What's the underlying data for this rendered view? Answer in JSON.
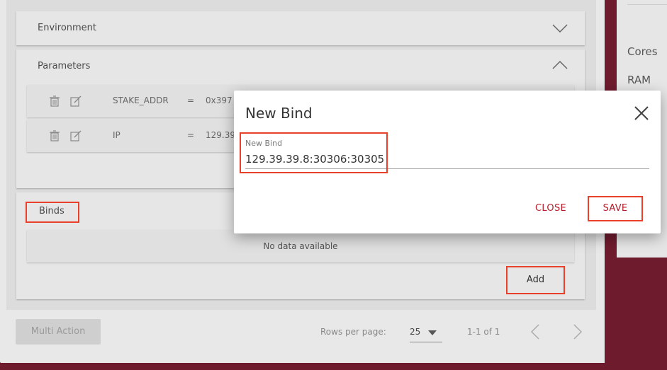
{
  "panels": {
    "environment": {
      "title": "Environment"
    },
    "parameters": {
      "title": "Parameters",
      "rows": [
        {
          "key": "STAKE_ADDR",
          "eq": "=",
          "value": "0x397"
        },
        {
          "key": "IP",
          "eq": "=",
          "value": "129.39."
        }
      ]
    },
    "binds": {
      "title": "Binds",
      "empty_text": "No data available",
      "add_label": "Add"
    }
  },
  "footer": {
    "multi_action": "Multi Action",
    "rows_per_page_label": "Rows per page:",
    "rows_per_page_value": "25",
    "range": "1-1 of 1"
  },
  "right_panel": {
    "cores": "Cores",
    "ram": "RAM"
  },
  "dialog": {
    "title": "New Bind",
    "field_label": "New Bind",
    "field_value": "129.39.39.8:30306:30305",
    "close_label": "CLOSE",
    "save_label": "SAVE"
  },
  "colors": {
    "accent": "#b71c2a",
    "highlight": "#e8402a",
    "backdrop": "#6f1b2e"
  },
  "icons": [
    "trash-icon",
    "edit-icon",
    "chevron-down-icon",
    "chevron-up-icon",
    "close-icon",
    "caret-down-icon",
    "chevron-left-icon",
    "chevron-right-icon"
  ]
}
